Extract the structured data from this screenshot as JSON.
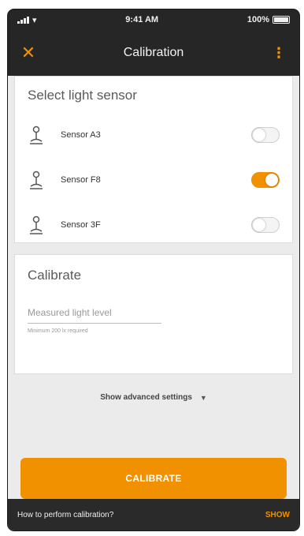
{
  "status_bar": {
    "time": "9:41 AM",
    "battery": "100%"
  },
  "app_bar": {
    "title": "Calibration",
    "close_icon": "close-icon",
    "menu_icon": "more-vertical-icon"
  },
  "sensors": {
    "heading": "Select light sensor",
    "items": [
      {
        "label": "Sensor A3",
        "enabled": false
      },
      {
        "label": "Sensor F8",
        "enabled": true
      },
      {
        "label": "Sensor 3F",
        "enabled": false
      }
    ]
  },
  "calibrate": {
    "heading": "Calibrate",
    "input_placeholder": "Measured light level",
    "input_value": "",
    "hint": "Minimum 200 lx required"
  },
  "advanced": {
    "label": "Show advanced settings"
  },
  "button": {
    "label": "CALIBRATE"
  },
  "bottom_bar": {
    "question": "How to perform calibration?",
    "action": "SHOW"
  },
  "colors": {
    "accent": "#f29100",
    "dark": "#262626",
    "background": "#ebebeb"
  }
}
